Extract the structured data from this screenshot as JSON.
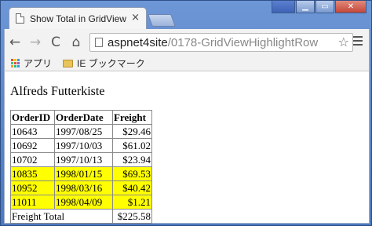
{
  "tab": {
    "title": "Show Total in GridView",
    "close": "×"
  },
  "window": {
    "minimize": "▁",
    "restore": "▭",
    "close": "✕"
  },
  "toolbar": {
    "back": "←",
    "forward": "→",
    "reload": "C",
    "home": "⌂",
    "url_host": "aspnet4site",
    "url_path": "/0178-GridViewHighlightRow",
    "star": "☆"
  },
  "bookmarks": {
    "apps_label": "アプリ",
    "folder_label": "IE ブックマーク"
  },
  "colors": {
    "highlight": "#ffff00",
    "apps": [
      "#e84c3d",
      "#f1c40f",
      "#3498db",
      "#2ecc71",
      "#e84c3d",
      "#9b59b6",
      "#f39c12",
      "#1abc9c",
      "#3498db"
    ]
  },
  "page": {
    "company": "Alfreds Futterkiste",
    "grid": {
      "headers": [
        "OrderID",
        "OrderDate",
        "Freight"
      ],
      "rows": [
        {
          "id": "10643",
          "date": "1997/08/25",
          "freight": "$29.46",
          "highlight": false
        },
        {
          "id": "10692",
          "date": "1997/10/03",
          "freight": "$61.02",
          "highlight": false
        },
        {
          "id": "10702",
          "date": "1997/10/13",
          "freight": "$23.94",
          "highlight": false
        },
        {
          "id": "10835",
          "date": "1998/01/15",
          "freight": "$69.53",
          "highlight": true
        },
        {
          "id": "10952",
          "date": "1998/03/16",
          "freight": "$40.42",
          "highlight": true
        },
        {
          "id": "11011",
          "date": "1998/04/09",
          "freight": "$1.21",
          "highlight": true
        }
      ],
      "footer": {
        "label": "Freight Total",
        "total": "$225.58"
      }
    }
  }
}
